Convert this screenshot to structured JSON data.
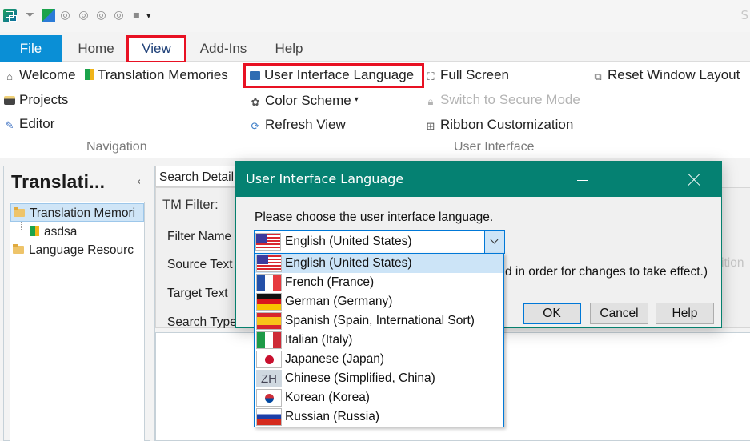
{
  "quick_access": {
    "icons": [
      "app-icon",
      "clear-filter-icon",
      "plugin-icon",
      "tm-icon-1",
      "tm-icon-2",
      "tm-add-icon-1",
      "tm-add-icon-2",
      "save-icon",
      "customize-toolbar-icon"
    ],
    "title_fragment": "S"
  },
  "tabs": [
    {
      "label": "File"
    },
    {
      "label": "Home"
    },
    {
      "label": "View",
      "active": true
    },
    {
      "label": "Add-Ins"
    },
    {
      "label": "Help"
    }
  ],
  "ribbon": {
    "navigation": {
      "label": "Navigation",
      "items": [
        {
          "label": "Welcome",
          "icon": "home-icon"
        },
        {
          "label": "Translation Memories",
          "icon": "translation-memories-icon"
        },
        {
          "label": "Projects",
          "icon": "projects-icon"
        },
        {
          "label": "Editor",
          "icon": "pencil-icon"
        }
      ]
    },
    "user_interface": {
      "label": "User Interface",
      "items": [
        {
          "label": "User Interface Language",
          "icon": "language-icon"
        },
        {
          "label": "Color Scheme",
          "icon": "palette-icon"
        },
        {
          "label": "Refresh View",
          "icon": "refresh-icon"
        },
        {
          "label": "Full Screen",
          "icon": "fullscreen-icon"
        },
        {
          "label": "Switch to Secure Mode",
          "icon": "lock-icon",
          "disabled": true
        },
        {
          "label": "Ribbon Customization",
          "icon": "ribbon-customization-icon"
        },
        {
          "label": "Reset Window Layout",
          "icon": "reset-layout-icon"
        }
      ]
    }
  },
  "left_panel": {
    "title": "Translati...",
    "collapse": "‹",
    "tree": [
      {
        "label": "Translation Memori",
        "selected": true
      },
      {
        "label": "asdsa"
      },
      {
        "label": "Language Resourc"
      }
    ]
  },
  "search_panel": {
    "tab": "Search Detail",
    "tm_filter": "TM Filter:",
    "labels": [
      "Filter Name",
      "Source Text",
      "Target Text",
      "Search Type"
    ],
    "faded_right": "ition"
  },
  "dialog": {
    "title": "User Interface Language",
    "prompt": "Please choose the user interface language.",
    "selected": "English (United States)",
    "note": "d in order for changes to take effect.)",
    "buttons": {
      "ok": "OK",
      "cancel": "Cancel",
      "help": "Help"
    },
    "options": [
      {
        "label": "English (United States)",
        "flag": "us",
        "selected": true
      },
      {
        "label": "French (France)",
        "flag": "fr"
      },
      {
        "label": "German (Germany)",
        "flag": "de"
      },
      {
        "label": "Spanish (Spain, International Sort)",
        "flag": "es"
      },
      {
        "label": "Italian (Italy)",
        "flag": "it"
      },
      {
        "label": "Japanese (Japan)",
        "flag": "jp"
      },
      {
        "label": "Chinese (Simplified, China)",
        "flag": "zh",
        "flag_text": "ZH"
      },
      {
        "label": "Korean (Korea)",
        "flag": "kr"
      },
      {
        "label": "Russian (Russia)",
        "flag": "ru"
      }
    ]
  },
  "colors": {
    "file_tab": "#0a8fd6",
    "dialog_titlebar": "#058172",
    "highlight": "#e81123",
    "selection": "#cce4f7",
    "accent_border": "#0078d7"
  }
}
